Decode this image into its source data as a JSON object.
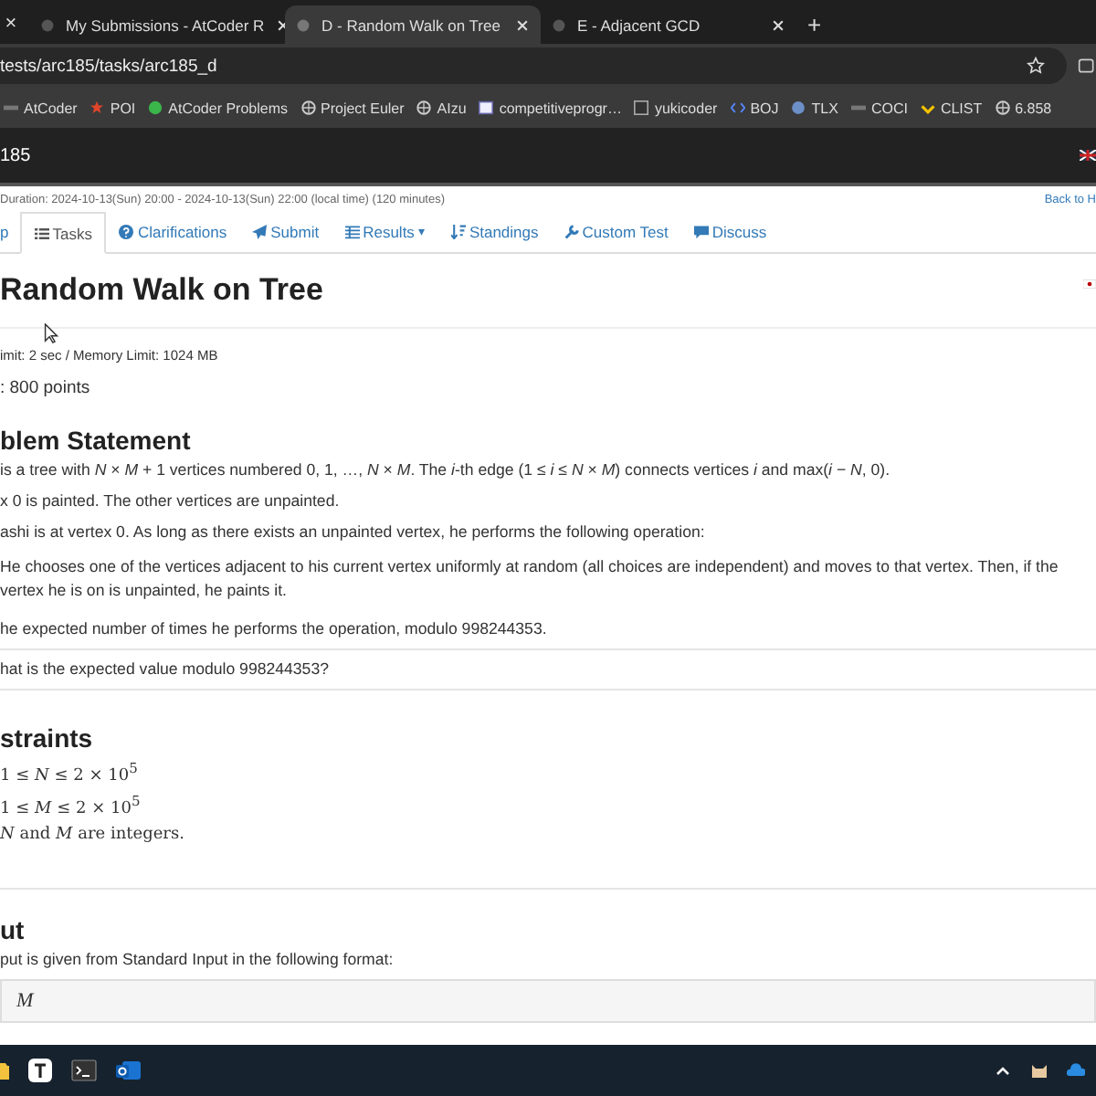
{
  "browser": {
    "partial_tab_close": "×",
    "tabs": [
      {
        "title": "My Submissions - AtCoder R",
        "selected": false
      },
      {
        "title": "D - Random Walk on Tree",
        "selected": true
      },
      {
        "title": "E - Adjacent GCD",
        "selected": false
      }
    ],
    "new_tab": "+",
    "address": "tests/arc185/tasks/arc185_d",
    "bookmarks": [
      {
        "label": "AtCoder"
      },
      {
        "label": "POI"
      },
      {
        "label": "AtCoder Problems"
      },
      {
        "label": "Project Euler"
      },
      {
        "label": "AIzu"
      },
      {
        "label": "competitiveprogr…"
      },
      {
        "label": "yukicoder"
      },
      {
        "label": "BOJ"
      },
      {
        "label": "TLX"
      },
      {
        "label": "COCI"
      },
      {
        "label": "CLIST"
      },
      {
        "label": "6.858"
      }
    ]
  },
  "site_header": {
    "contest": "185"
  },
  "contest_bar": {
    "duration": "Duration: 2024-10-13(Sun) 20:00 - 2024-10-13(Sun) 22:00 (local time) (120 minutes)",
    "back_link": "Back to H"
  },
  "nav_tabs": [
    {
      "label": "p",
      "selected": false
    },
    {
      "label": "Tasks",
      "selected": true
    },
    {
      "label": "Clarifications",
      "selected": false
    },
    {
      "label": "Submit",
      "selected": false
    },
    {
      "label": "Results",
      "selected": false,
      "caret": "▾"
    },
    {
      "label": "Standings",
      "selected": false
    },
    {
      "label": "Custom Test",
      "selected": false
    },
    {
      "label": "Discuss",
      "selected": false
    }
  ],
  "task": {
    "title": "Random Walk on Tree",
    "limits": "imit: 2 sec / Memory Limit: 1024 MB",
    "score": ": 800 points"
  },
  "statement": {
    "heading": "blem Statement",
    "blocks": [
      {
        "kind": "text",
        "lines": [
          "is a tree with *N* × *M* + 1 vertices numbered 0, 1, …, *N* × *M*. The *i*-th edge (1 ≤ *i* ≤ *N* × *M*) connects vertices *i* and max(*i* − *N*, 0)."
        ]
      },
      {
        "kind": "text",
        "lines": [
          "x 0 is painted. The other vertices are unpainted."
        ]
      },
      {
        "kind": "text",
        "lines": [
          "ashi is at vertex 0. As long as there exists an unpainted vertex, he performs the following operation:"
        ]
      },
      {
        "kind": "indented",
        "lines": [
          "He chooses one of the vertices adjacent to his current vertex uniformly at random (all choices are independent) and moves to that vertex. Then, if the",
          "vertex he is on is unpainted, he paints it."
        ]
      },
      {
        "kind": "text",
        "lines": [
          "he expected number of times he performs the operation, modulo 998244353."
        ]
      },
      {
        "kind": "question",
        "lines": [
          "hat is the expected value modulo 998244353?"
        ]
      }
    ]
  },
  "constraints": {
    "heading": "straints",
    "items": [
      "1 ≤ *N* ≤ 2 × 10$^{5}$",
      "1 ≤ *M* ≤ 2 × 10$^{5}$",
      "*N* and *M* are integers."
    ]
  },
  "input": {
    "heading": "ut",
    "text": "put is given from Standard Input in the following format:",
    "format": "M"
  }
}
